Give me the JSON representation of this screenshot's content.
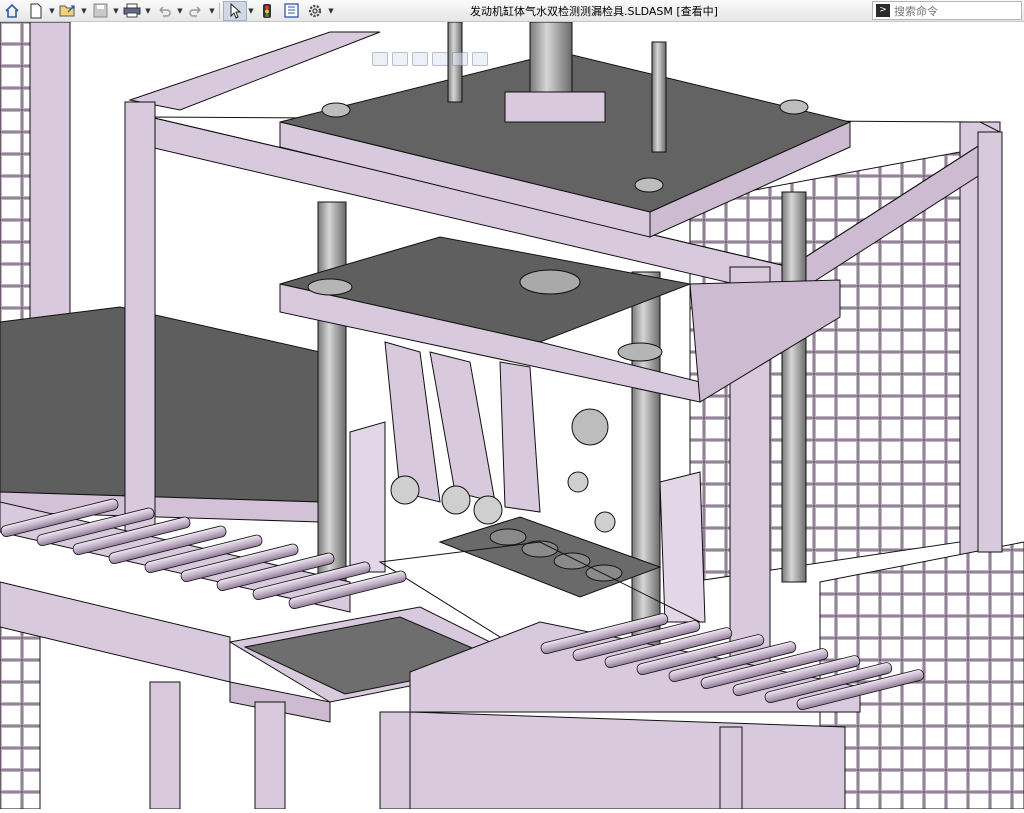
{
  "window": {
    "title": "发动机缸体气水双检测测漏检具.SLDASM [查看中]"
  },
  "search": {
    "placeholder": "搜索命令"
  },
  "toolbar": {
    "buttons": [
      {
        "name": "home-icon",
        "dd": false
      },
      {
        "name": "new-document-icon",
        "dd": true
      },
      {
        "name": "open-folder-icon",
        "dd": true
      },
      {
        "name": "save-icon",
        "dd": true
      },
      {
        "name": "print-icon",
        "dd": true
      },
      {
        "name": "undo-icon",
        "dd": true
      },
      {
        "name": "redo-icon",
        "dd": true
      },
      {
        "name": "select-pointer-icon",
        "dd": true
      },
      {
        "name": "traffic-light-icon",
        "dd": false
      },
      {
        "name": "file-properties-icon",
        "dd": false
      },
      {
        "name": "options-gear-icon",
        "dd": true
      }
    ]
  },
  "colors": {
    "frame": "#d9c9dd",
    "frame_dark": "#b9a6be",
    "plate": "#636363",
    "plate_dark": "#4c4c4c",
    "edge": "#111111",
    "roller": "#cfc1d3"
  }
}
